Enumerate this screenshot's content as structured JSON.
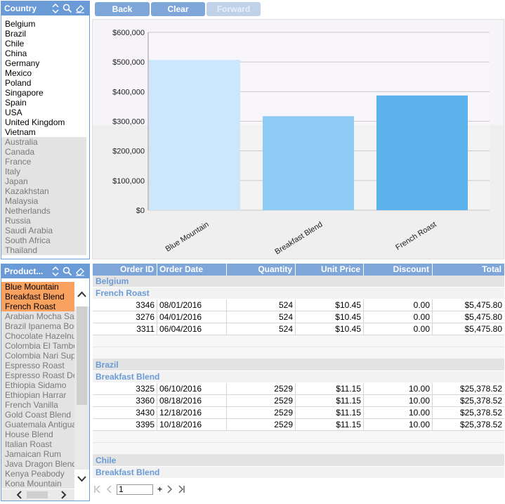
{
  "country_filter": {
    "title": "Country",
    "selected": [
      "Belgium",
      "Brazil",
      "Chile",
      "China",
      "Germany",
      "Mexico",
      "Poland",
      "Singapore",
      "Spain",
      "USA",
      "United Kingdom",
      "Vietnam"
    ],
    "unselected": [
      "Australia",
      "Canada",
      "France",
      "Italy",
      "Japan",
      "Kazakhstan",
      "Malaysia",
      "Netherlands",
      "Russia",
      "Saudi Arabia",
      "South Africa",
      "Thailand"
    ]
  },
  "product_filter": {
    "title": "Product...",
    "highlighted": [
      "Blue Mountain",
      "Breakfast Blend",
      "French Roast"
    ],
    "others": [
      "Arabian Mocha Sanani",
      "Brazil Ipanema Bourbon",
      "Chocolate Hazelnut",
      "Colombia El Tambo",
      "Colombia Nari Supremo",
      "Espresso Roast",
      "Espresso Roast Decaf",
      "Ethiopia Sidamo",
      "Ethiopian Harrar",
      "French Vanilla",
      "Gold Coast Blend",
      "Guatemala Antigua",
      "House Blend",
      "Italian Roast",
      "Jamaican Rum",
      "Java Dragon Blend",
      "Kenya Peabody",
      "Kona Mountain"
    ]
  },
  "toolbar": {
    "back": "Back",
    "clear": "Clear",
    "forward": "Forward"
  },
  "chart_data": {
    "type": "bar",
    "categories": [
      "Blue Mountain",
      "Breakfast Blend",
      "French Roast"
    ],
    "values": [
      507000,
      317000,
      387000
    ],
    "colors": [
      "#cce6fb",
      "#8ecbf5",
      "#5cb2ea"
    ],
    "ylim": [
      0,
      600000
    ],
    "yticks": [
      "$0",
      "$100,000",
      "$200,000",
      "$300,000",
      "$400,000",
      "$500,000",
      "$600,000"
    ],
    "grid": true
  },
  "table": {
    "columns": [
      "Order ID",
      "Order Date",
      "Quantity",
      "Unit Price",
      "Discount",
      "Total"
    ],
    "groups": [
      {
        "country": "Belgium",
        "product": "French Roast",
        "rows": [
          [
            "3346",
            "08/01/2016",
            "524",
            "$10.45",
            "0.00",
            "$5,475.80"
          ],
          [
            "3276",
            "04/01/2016",
            "524",
            "$10.45",
            "0.00",
            "$5,475.80"
          ],
          [
            "3311",
            "06/04/2016",
            "524",
            "$10.45",
            "0.00",
            "$5,475.80"
          ]
        ]
      },
      {
        "country": "Brazil",
        "product": "Breakfast Blend",
        "rows": [
          [
            "3325",
            "06/10/2016",
            "2529",
            "$11.15",
            "10.00",
            "$25,378.52"
          ],
          [
            "3360",
            "08/18/2016",
            "2529",
            "$11.15",
            "10.00",
            "$25,378.52"
          ],
          [
            "3430",
            "12/18/2016",
            "2529",
            "$11.15",
            "10.00",
            "$25,378.52"
          ],
          [
            "3395",
            "10/18/2016",
            "2529",
            "$11.15",
            "10.00",
            "$25,378.52"
          ]
        ]
      },
      {
        "country": "Chile",
        "product": "Breakfast Blend",
        "rows": []
      }
    ]
  },
  "pager": {
    "page": "1",
    "add_label": "+"
  }
}
